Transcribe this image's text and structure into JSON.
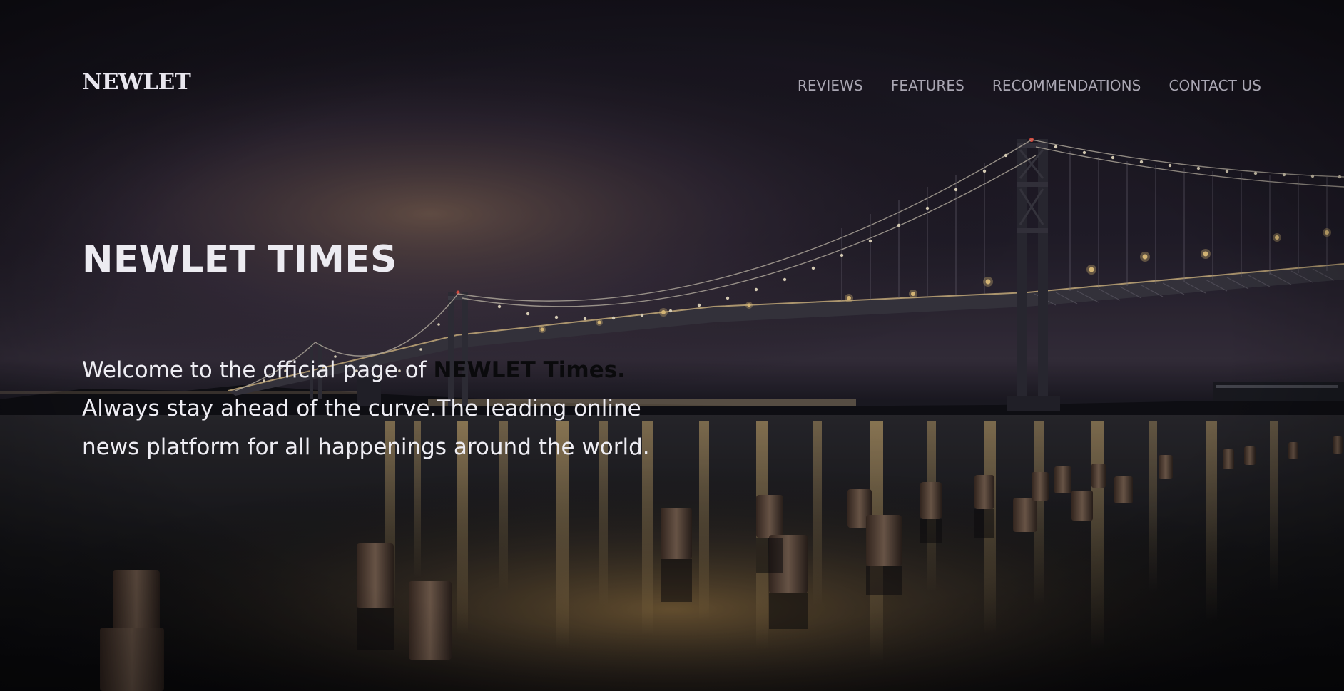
{
  "brand": {
    "logo": "NEWLET"
  },
  "nav": {
    "items": [
      {
        "label": "REVIEWS"
      },
      {
        "label": "FEATURES"
      },
      {
        "label": "RECOMMENDATIONS"
      },
      {
        "label": "CONTACT US"
      }
    ]
  },
  "hero": {
    "title": "NEWLET TIMES",
    "intro_before": "Welcome to the official page of ",
    "intro_brand": "NEWLET Times.",
    "intro_after": " Always stay ahead of the curve.The leading online news platform for all happenings around the world."
  },
  "background": {
    "image": "night-suspension-bridge-over-bay-with-wooden-pier-posts",
    "sky_color": "#1a1722",
    "glow_color": "#e7b56a",
    "light_color": "#fff1c4"
  }
}
